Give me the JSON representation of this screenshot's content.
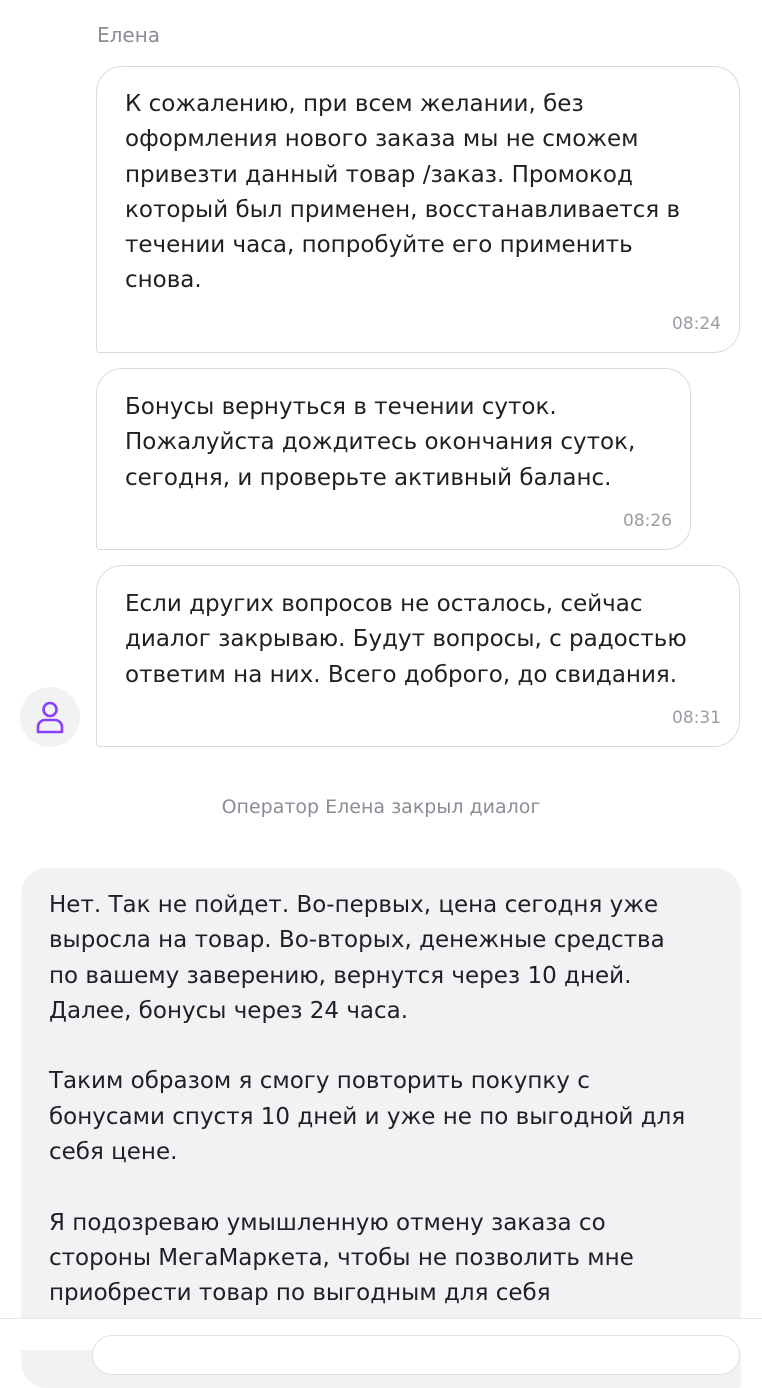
{
  "operator": {
    "name": "Елена"
  },
  "messages": [
    {
      "text": "К сожалению, при всем желании, без\nоформления нового заказа мы не сможем\nпривезти данный товар /заказ. Промокод\nкоторый был применен, восстанавливается в\nтечении часа, попробуйте его применить\nснова.",
      "time": "08:24"
    },
    {
      "text": "Бонусы вернуться в течении суток.\nПожалуйста дождитесь окончания суток,\nсегодня, и проверьте активный баланс.",
      "time": "08:26"
    },
    {
      "text": "Если других вопросов не осталось, сейчас\nдиалог закрываю. Будут вопросы, с радостью\nответим на них. Всего доброго, до свидания.",
      "time": "08:31"
    }
  ],
  "system_message": "Оператор Елена закрыл диалог",
  "user_message": {
    "text": "Нет. Так не пойдет. Во-первых, цена сегодня уже\nвыросла на товар. Во-вторых, денежные средства\nпо вашему заверению, вернутся через 10 дней.\nДалее, бонусы через 24 часа.\n\nТаким образом я смогу повторить покупку с\nбонусами спустя 10 дней и уже не по выгодной для\nсебя цене.\n\nЯ подозреваю умышленную отмену заказа со\nстороны МегаМаркета, чтобы не позволить мне\nприобрести товар по выгодным для себя"
  },
  "icons": {
    "avatar": "user-icon"
  },
  "colors": {
    "accent": "#8a3ffc",
    "user_bubble": "#f1f2f4",
    "bubble_border": "#d9dbe0",
    "muted_text": "#8a8d96"
  }
}
